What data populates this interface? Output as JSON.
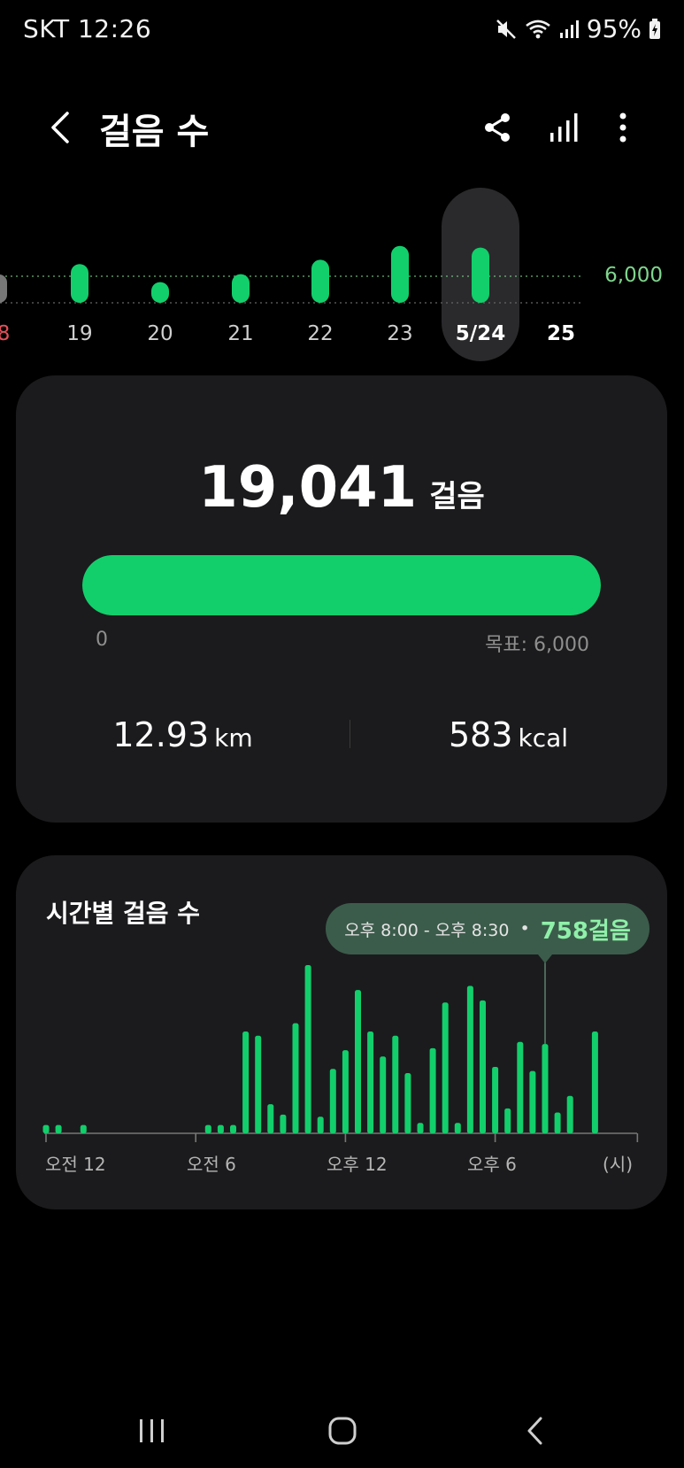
{
  "status_bar": {
    "carrier_time": "SKT 12:26",
    "battery": "95%",
    "icons": [
      "mute-icon",
      "wifi-icon",
      "signal-icon",
      "battery-charging-icon"
    ]
  },
  "header": {
    "title": "걸음 수",
    "actions": [
      "share-icon",
      "chart-icon",
      "more-icon"
    ]
  },
  "days": {
    "labels": [
      "8",
      "19",
      "20",
      "21",
      "22",
      "23",
      "5/24",
      "25"
    ],
    "goal_label": "6,000",
    "selected_index": 6,
    "values_relative_to_goal": [
      null,
      1.46,
      0.78,
      1.08,
      1.62,
      2.14,
      2.08,
      null
    ]
  },
  "summary": {
    "steps": "19,041",
    "steps_unit": "걸음",
    "progress_min": "0",
    "progress_goal": "목표: 6,000",
    "progress_fraction": 1.0,
    "distance": "12.93",
    "distance_unit": "km",
    "calories": "583",
    "calories_unit": "kcal"
  },
  "hourly": {
    "title": "시간별 걸음 수",
    "tooltip_range": "오후 8:00 - 오후 8:30",
    "tooltip_value": "758걸음",
    "axis_labels": [
      "오전 12",
      "오전 6",
      "오후 12",
      "오후 6",
      "(시)"
    ],
    "bar_values": [
      40,
      40,
      0,
      40,
      0,
      0,
      0,
      0,
      0,
      0,
      0,
      0,
      0,
      40,
      40,
      40,
      490,
      470,
      140,
      90,
      530,
      810,
      80,
      310,
      400,
      690,
      490,
      370,
      470,
      290,
      50,
      410,
      630,
      50,
      710,
      640,
      320,
      120,
      440,
      300,
      430,
      100,
      180,
      0,
      490,
      0
    ],
    "selected_index": 40
  },
  "colors": {
    "accent": "#12cf6b",
    "card": "#1b1b1d",
    "tooltip_bg": "#3c5c4b",
    "weekend_red": "#e0505a",
    "goal_green": "#7fd58d"
  },
  "nav_bar": [
    "recent-apps-icon",
    "home-icon",
    "back-icon"
  ]
}
